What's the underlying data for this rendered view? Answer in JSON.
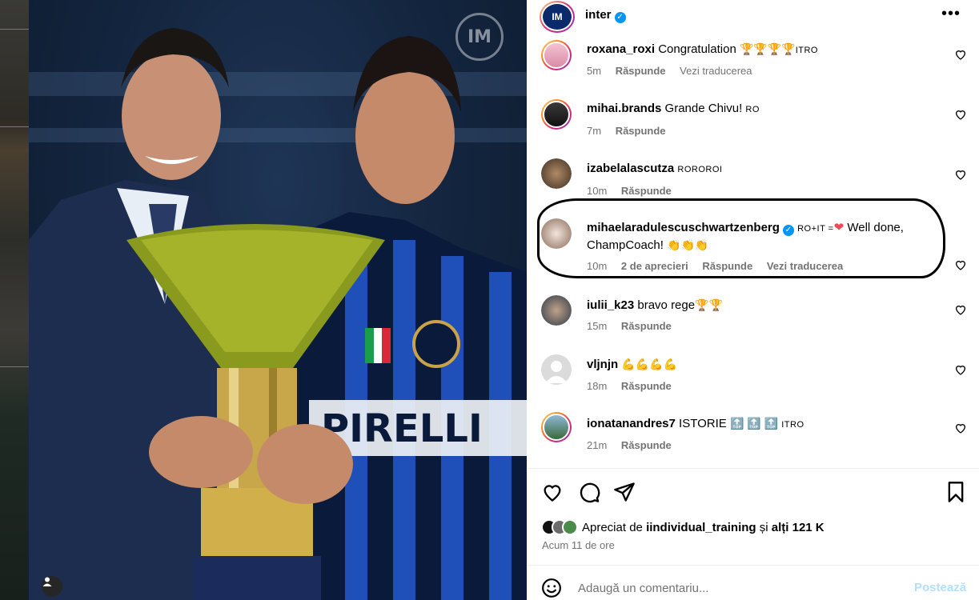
{
  "post": {
    "account": "inter",
    "menu_icon": "more-horizontal-icon"
  },
  "comments": [
    {
      "user": "roxana_roxi",
      "text": "Congratulation",
      "emoji": "🏆🏆🏆🏆",
      "tag": "ITRO",
      "time": "5m",
      "reply": "Răspunde",
      "translate": "Vezi traducerea"
    },
    {
      "user": "mihai.brands",
      "text": "Grande Chivu!",
      "tag": "RO",
      "time": "7m",
      "reply": "Răspunde"
    },
    {
      "user": "izabelalascutza",
      "tag": "ROROROI",
      "time": "10m",
      "reply": "Răspunde"
    },
    {
      "user": "mihaelaradulescuschwartzenberg",
      "tag": "RO+IT =",
      "text": "Well done, ChampCoach!",
      "emoji": "👏👏👏",
      "time": "10m",
      "likes": "2 de aprecieri",
      "reply": "Răspunde",
      "translate": "Vezi traducerea"
    },
    {
      "user": "iulii_k23",
      "text": "bravo rege",
      "emoji": "🏆🏆",
      "time": "15m",
      "reply": "Răspunde"
    },
    {
      "user": "vljnjn",
      "emoji": "💪💪💪💪",
      "time": "18m",
      "reply": "Răspunde"
    },
    {
      "user": "ionatanandres7",
      "text": "ISTORIE",
      "emoji": "🔝 🔝 🔝",
      "tag": "ITRO",
      "time": "21m",
      "reply": "Răspunde"
    }
  ],
  "likes": {
    "prefix": "Apreciat de",
    "user": "iindividual_training",
    "middle": "și",
    "rest": "alți 121 K"
  },
  "time_ago": "Acum 11 de ore",
  "composer": {
    "placeholder": "Adaugă un comentariu...",
    "post_label": "Postează"
  },
  "colors": {
    "accent": "#0095f6",
    "post_disabled": "#b2dffc",
    "heart_red": "#ed4956",
    "photo_bg": "#142640"
  }
}
